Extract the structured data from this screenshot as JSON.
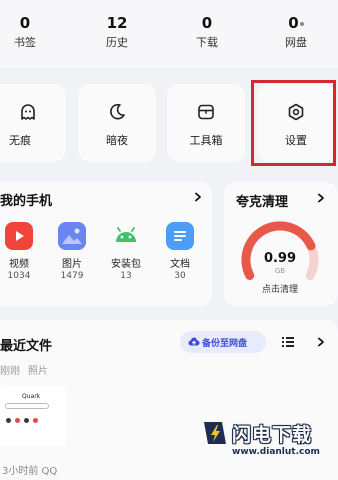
{
  "stats": [
    {
      "value": "0",
      "label": "书签"
    },
    {
      "value": "12",
      "label": "历史"
    },
    {
      "value": "0",
      "label": "下载"
    },
    {
      "value": "0",
      "label": "网盘"
    }
  ],
  "shortcuts": [
    {
      "label": "无痕",
      "icon": "ghost-icon"
    },
    {
      "label": "暗夜",
      "icon": "moon-icon"
    },
    {
      "label": "工具箱",
      "icon": "toolbox-icon"
    },
    {
      "label": "设置",
      "icon": "settings-hexagon-icon"
    }
  ],
  "my_phone": {
    "title": "我的手机",
    "apps": [
      {
        "name": "视频",
        "count": "1034",
        "icon": "video-icon",
        "color": "#f0433a"
      },
      {
        "name": "图片",
        "count": "1479",
        "icon": "image-icon",
        "color": "#5b8cf5"
      },
      {
        "name": "安装包",
        "count": "13",
        "icon": "android-icon",
        "color": "#3ec46d"
      },
      {
        "name": "文档",
        "count": "30",
        "icon": "document-icon",
        "color": "#4a9ef8"
      }
    ]
  },
  "clean": {
    "title": "夸克清理",
    "value": "0.99",
    "unit": "GB",
    "action": "点击清理",
    "gauge_fill": 0.78
  },
  "recent": {
    "title": "最近文件",
    "backup_label": "备份至网盘",
    "filters": [
      "刚刚",
      "照片"
    ],
    "thumb_title": "Quark",
    "file_meta": "3小时前 QQ"
  },
  "watermark": {
    "text": "闪电下载",
    "url": "www.dianlut.com"
  },
  "colors": {
    "accent": "#3a4bd8",
    "highlight": "#d8262f",
    "gauge": "#e9594a"
  }
}
